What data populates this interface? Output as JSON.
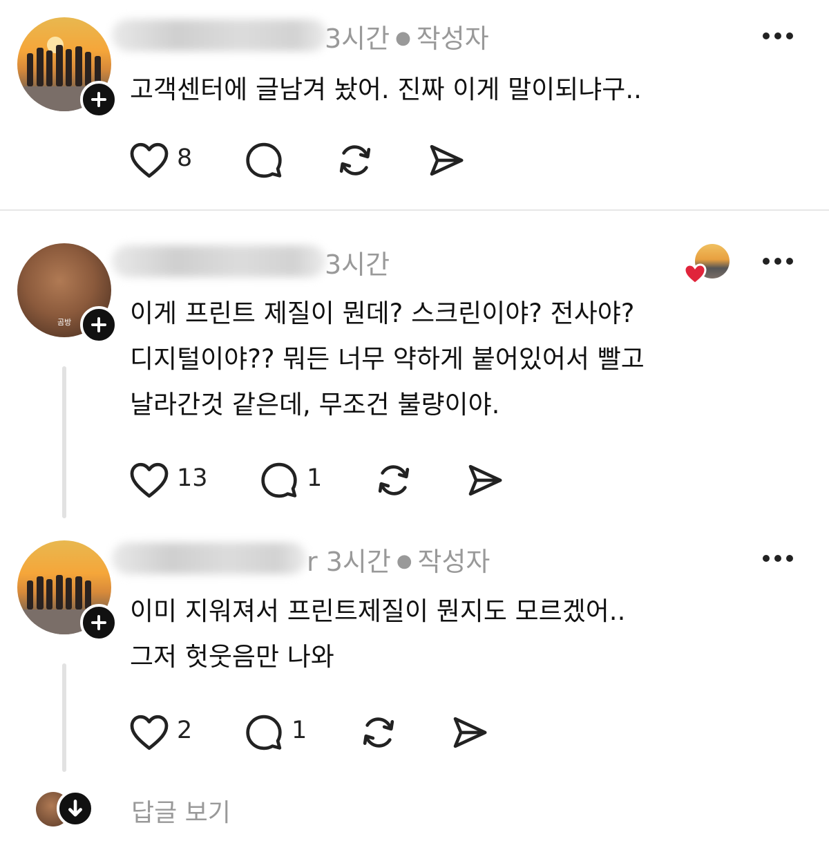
{
  "posts": [
    {
      "time": "3시간",
      "author_tag": "작성자",
      "text": [
        "고객센터에 글남겨 놨어. 진짜 이게 말이되냐구.."
      ],
      "likes": "8",
      "replies": ""
    },
    {
      "time": "3시간",
      "author_tag": "",
      "avatar_caption": "곰방",
      "text": [
        "이게 프린트 제질이 뭔데? 스크린이야? 전사야?",
        "디지털이야?? 뭐든 너무 약하게 붙어있어서 빨고",
        "날라간것 같은데, 무조건 불량이야."
      ],
      "likes": "13",
      "replies": "1",
      "liked_by_author": true
    },
    {
      "time": "3시간",
      "author_tag": "작성자",
      "name_tail": "r",
      "text": [
        "이미 지워져서 프린트제질이 뭔지도 모르겠어..",
        "그저 헛웃음만 나와"
      ],
      "likes": "2",
      "replies": "1"
    }
  ],
  "view_replies_label": "답글 보기",
  "icons": [
    "heart-icon",
    "comment-icon",
    "repost-icon",
    "share-icon",
    "more-icon",
    "follow-plus-icon",
    "arrow-down-icon"
  ],
  "colors": {
    "text": "#111111",
    "muted": "#999999",
    "like_heart": "#e0243b",
    "divider": "#e6e6e6"
  }
}
